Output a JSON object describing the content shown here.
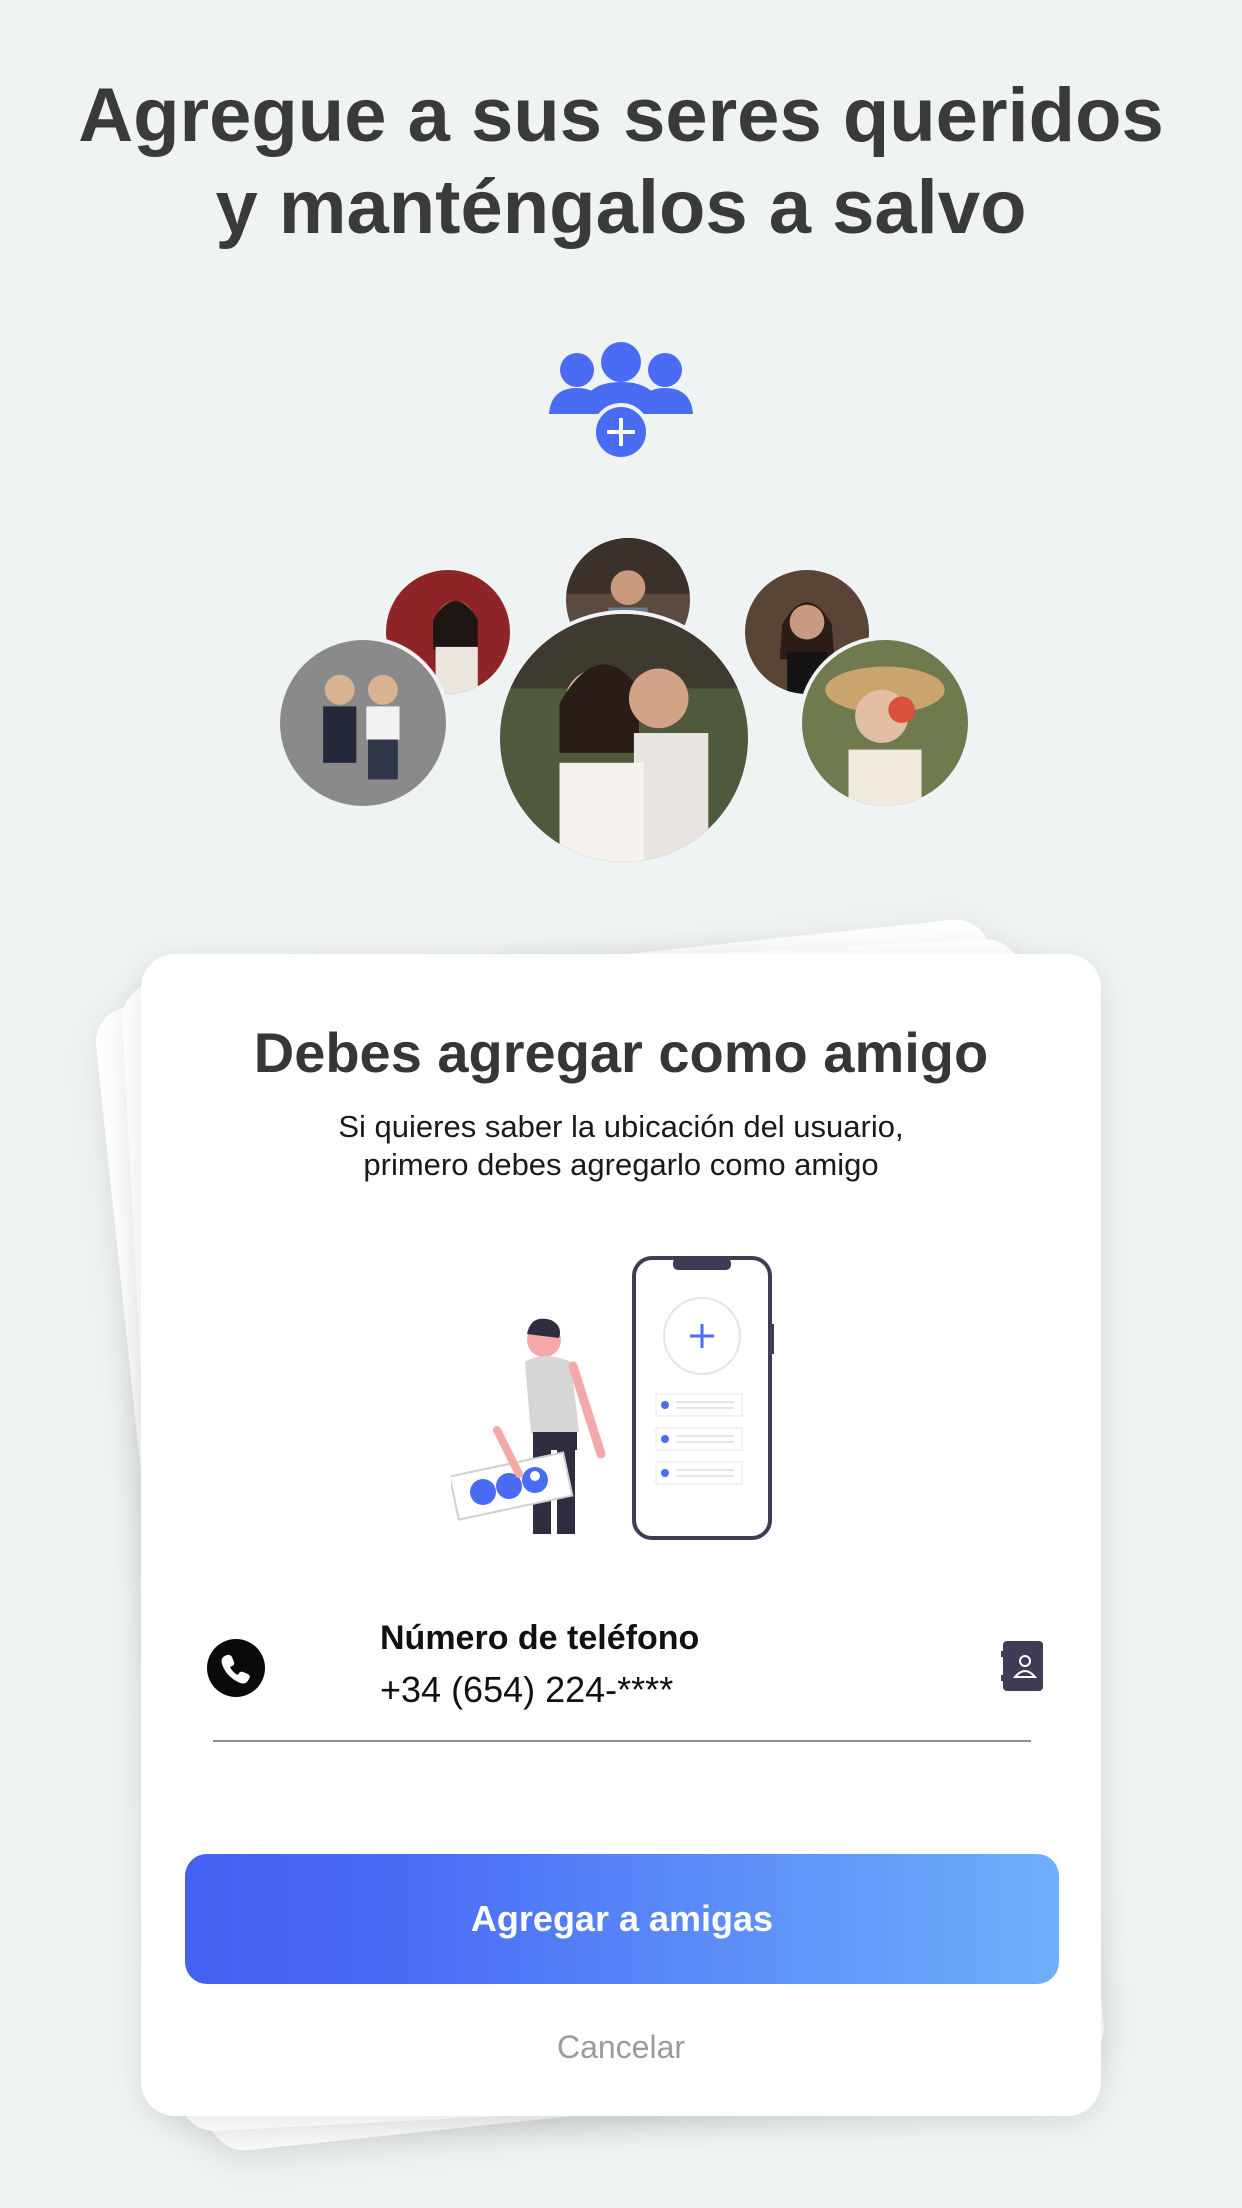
{
  "headline": {
    "line1": "Agregue a sus seres queridos",
    "line2": "y manténgalos a salvo"
  },
  "card": {
    "title": "Debes agregar como amigo",
    "subtitle_line1": "Si quieres saber la ubicación del usuario,",
    "subtitle_line2": "primero debes agregarlo como amigo",
    "phone": {
      "label": "Número de teléfono",
      "value": "+34 (654) 224-****",
      "icon": "phone-icon",
      "contacts_icon": "contacts-book-icon"
    },
    "add_button_label": "Agregar a amigas",
    "cancel_label": "Cancelar"
  },
  "colors": {
    "background": "#f0f3f4",
    "accent": "#4a6cf5",
    "accent_light": "#6fb0fb",
    "headline_text": "#3a3a3a",
    "cancel_text": "#9b9b9b"
  },
  "icons": [
    "group-add-icon",
    "phone-icon",
    "contacts-book-icon",
    "plus-icon"
  ]
}
